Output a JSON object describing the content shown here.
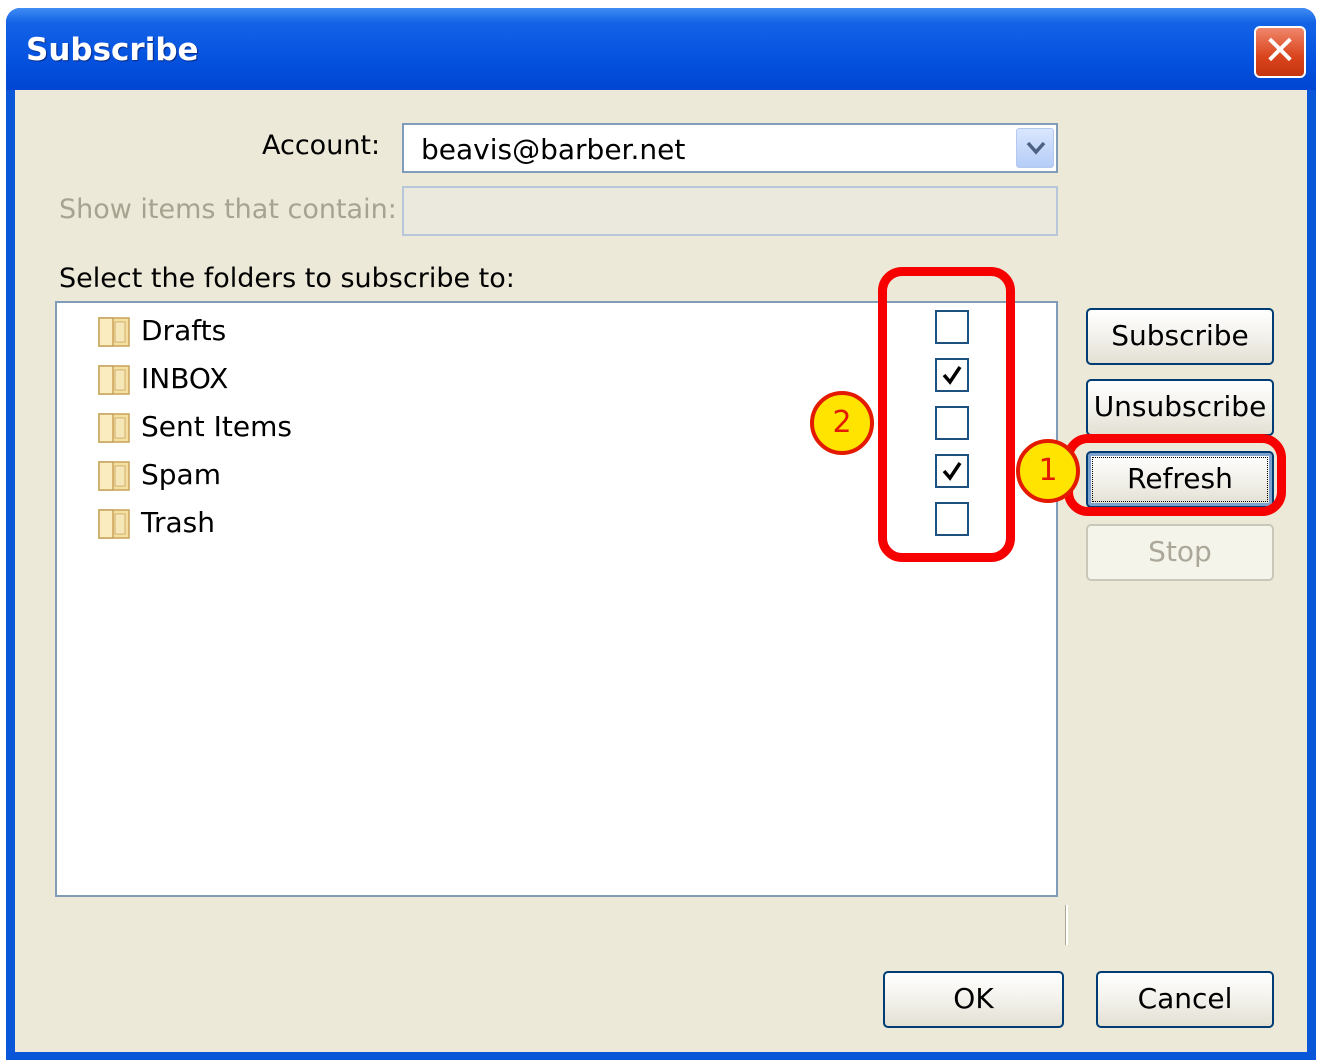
{
  "window": {
    "title": "Subscribe",
    "close_glyph": "✕"
  },
  "form": {
    "account_label": "Account:",
    "account_value": "beavis@barber.net",
    "filter_label": "Show items that contain:",
    "filter_value": "",
    "list_label": "Select the folders to subscribe to:"
  },
  "folders": [
    {
      "name": "Drafts",
      "subscribed": false
    },
    {
      "name": "INBOX",
      "subscribed": true
    },
    {
      "name": "Sent Items",
      "subscribed": false
    },
    {
      "name": "Spam",
      "subscribed": true
    },
    {
      "name": "Trash",
      "subscribed": false
    }
  ],
  "side_buttons": {
    "subscribe": "Subscribe",
    "unsubscribe": "Unsubscribe",
    "refresh": "Refresh",
    "stop": "Stop"
  },
  "footer_buttons": {
    "ok": "OK",
    "cancel": "Cancel"
  },
  "annotations": {
    "badge_1": "1",
    "badge_2": "2",
    "color": "#f70000",
    "badge_fill": "#ffe400"
  },
  "icons": {
    "folder": "folder-icon",
    "check": "checkmark-icon",
    "dropdown": "chevron-down-icon"
  }
}
